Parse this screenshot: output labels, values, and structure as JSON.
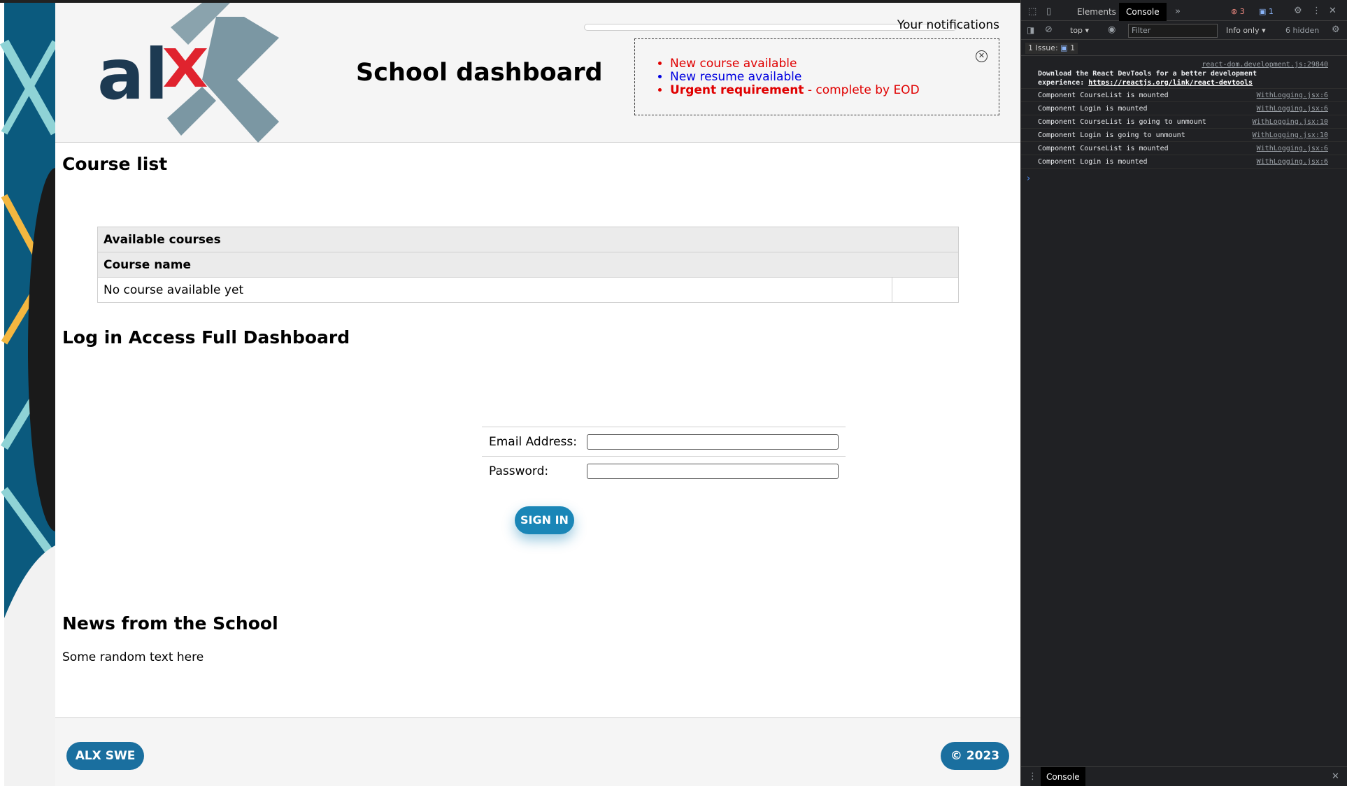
{
  "header": {
    "title": "School dashboard",
    "logo_text": "alx"
  },
  "notifications": {
    "label": "Your notifications",
    "items": [
      {
        "text": "New course available",
        "color": "#e00000"
      },
      {
        "text": "New resume available",
        "color": "#0000e0"
      },
      {
        "strong": "Urgent requirement",
        "rest": " - complete by EOD",
        "color": "#e00000"
      }
    ]
  },
  "course_list": {
    "title": "Course list",
    "table_title": "Available courses",
    "column_header": "Course name",
    "empty_text": "No course available yet"
  },
  "login": {
    "title": "Log in Access Full Dashboard",
    "email_label": "Email Address:",
    "password_label": "Password:",
    "email_value": "",
    "password_value": "",
    "submit_label": "SIGN IN"
  },
  "news": {
    "title": "News from the School",
    "text": "Some random text here"
  },
  "footer": {
    "left_label": "ALX SWE",
    "right_label": "© 2023"
  },
  "devtools": {
    "tabs": [
      "Elements",
      "Console"
    ],
    "active_tab": "Console",
    "errors_count": "3",
    "messages_count": "1",
    "context": "top",
    "filter_placeholder": "Filter",
    "level": "Info only",
    "hidden": "6 hidden",
    "issues": "1 Issue:",
    "issues_count": "1",
    "bottom_tab": "Console",
    "console": [
      {
        "text_lead": "Download the React DevTools for a better development",
        "text_cont": "experience: ",
        "link": "https://reactjs.org/link/react-devtools",
        "source": "react-dom.development.js:29840"
      },
      {
        "text": "Component CourseList is mounted",
        "source": "WithLogging.jsx:6"
      },
      {
        "text": "Component Login is mounted",
        "source": "WithLogging.jsx:6"
      },
      {
        "text": "Component CourseList is going to unmount",
        "source": "WithLogging.jsx:10"
      },
      {
        "text": "Component Login is going to unmount",
        "source": "WithLogging.jsx:10"
      },
      {
        "text": "Component CourseList is mounted",
        "source": "WithLogging.jsx:6"
      },
      {
        "text": "Component Login is mounted",
        "source": "WithLogging.jsx:6"
      }
    ]
  },
  "colors": {
    "brand_blue": "#1a6f9f",
    "signin_blue": "#1a86b7",
    "logo_red": "#e0232e",
    "logo_navy": "#1d3a52"
  }
}
